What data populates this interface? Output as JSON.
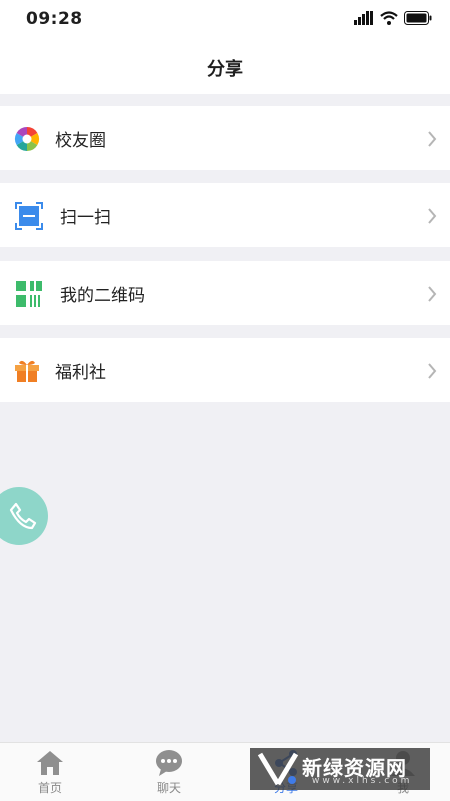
{
  "status": {
    "time": "09:28"
  },
  "header": {
    "title": "分享"
  },
  "menu": [
    {
      "label": "校友圈",
      "icon": "aperture-icon"
    },
    {
      "label": "扫一扫",
      "icon": "scan-icon"
    },
    {
      "label": "我的二维码",
      "icon": "qrcode-icon"
    },
    {
      "label": "福利社",
      "icon": "gift-icon"
    }
  ],
  "tabs": [
    {
      "label": "首页",
      "icon": "home-icon"
    },
    {
      "label": "聊天",
      "icon": "chat-icon"
    },
    {
      "label": "分享",
      "icon": "share-icon",
      "active": true
    },
    {
      "label": "我",
      "icon": "profile-icon"
    }
  ],
  "watermark": {
    "text": "新绿资源网",
    "sub": "www.xlhs.com"
  },
  "colors": {
    "accent": "#3f7be8",
    "fab": "#8ed6c9",
    "background": "#f0f0f4"
  }
}
